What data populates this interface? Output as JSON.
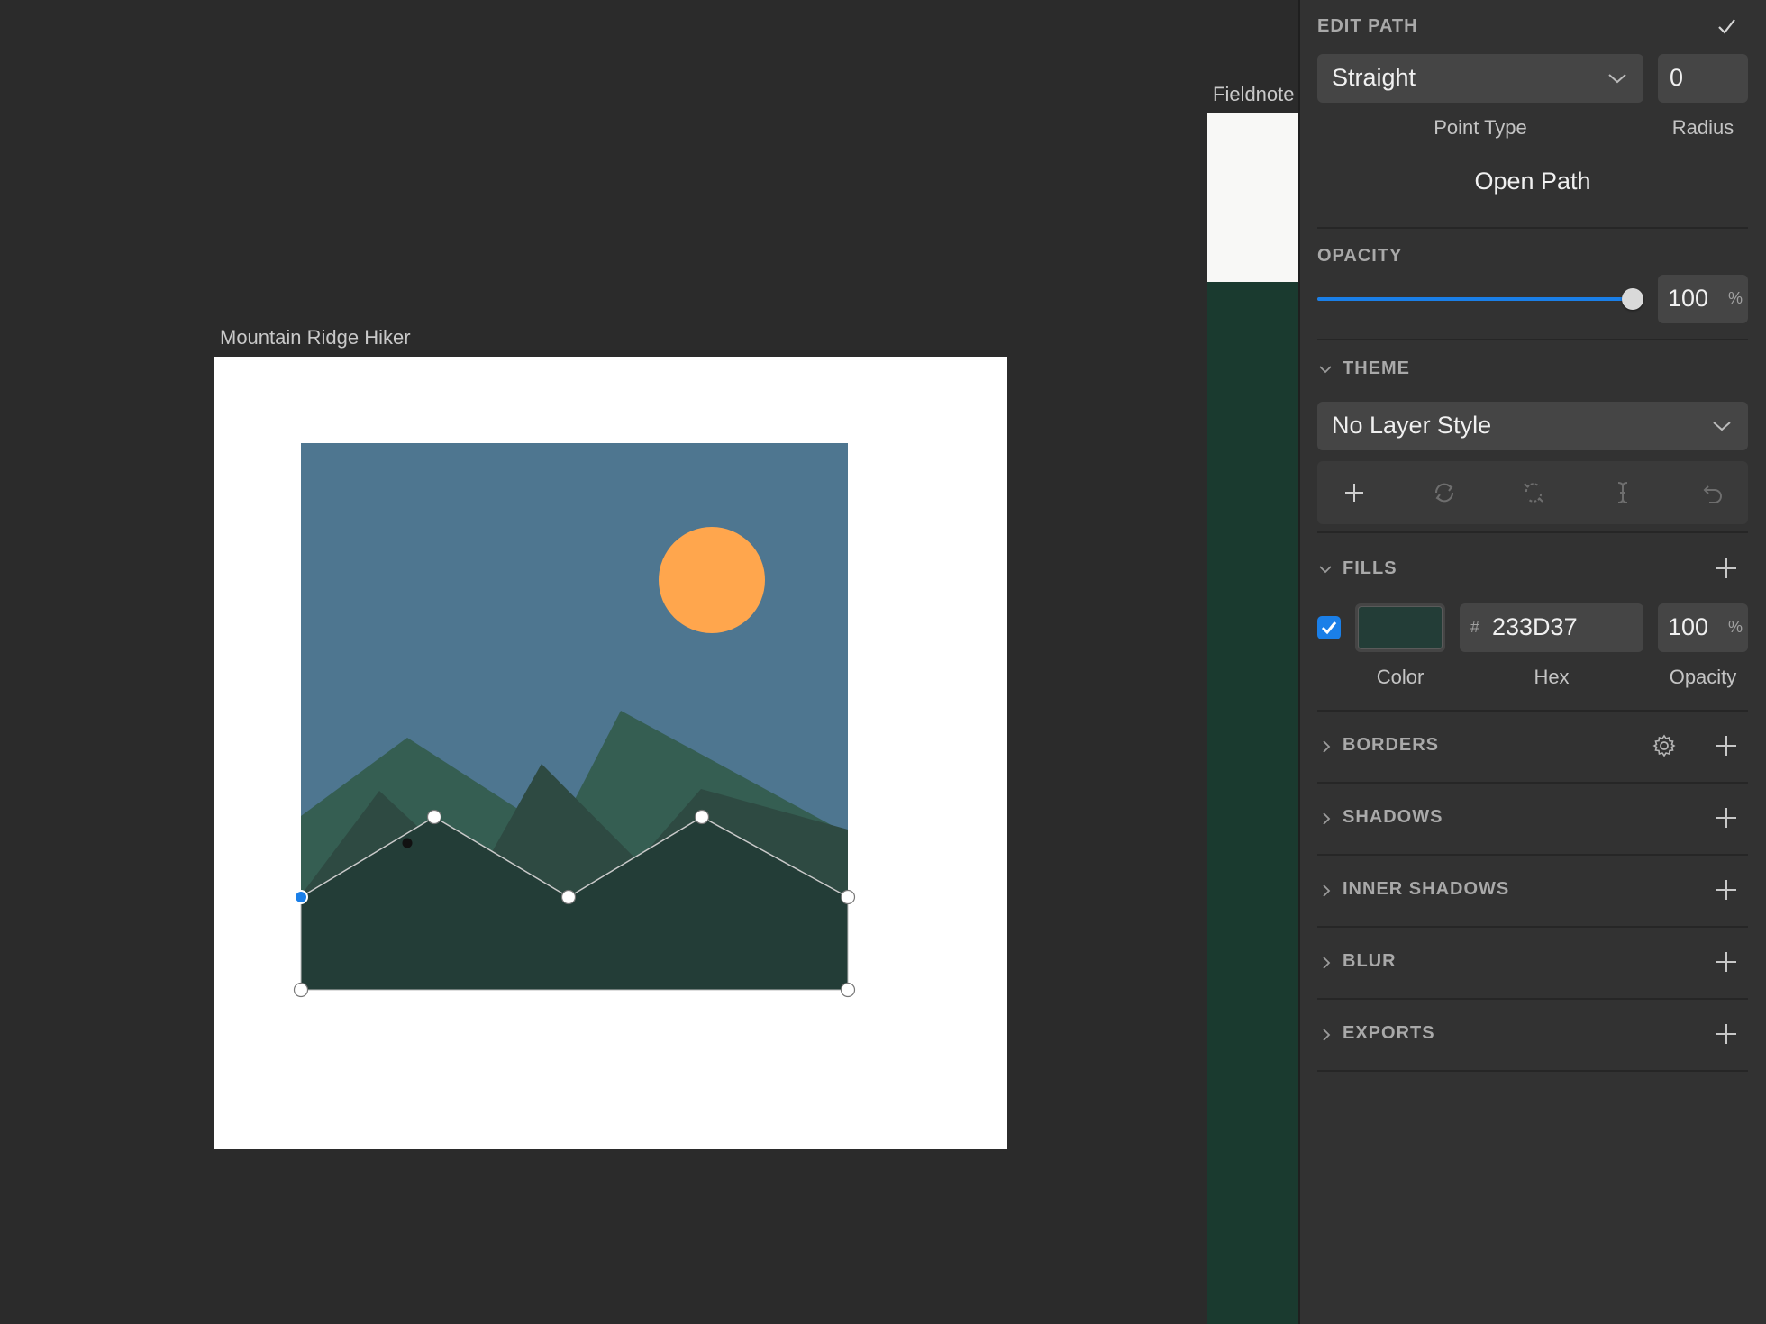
{
  "canvas": {
    "artboard1": {
      "title": "Mountain Ridge Hiker"
    },
    "artboard2": {
      "title": "Fieldnote"
    }
  },
  "inspector": {
    "edit_path": {
      "title": "EDIT PATH",
      "done_icon": "checkmark-icon",
      "point_type": {
        "value": "Straight",
        "caption": "Point Type"
      },
      "radius": {
        "value": "0",
        "caption": "Radius"
      },
      "open_path_label": "Open Path"
    },
    "opacity": {
      "title": "OPACITY",
      "value": "100",
      "unit": "%",
      "level": 1.0
    },
    "theme": {
      "title": "THEME",
      "layer_style": "No Layer Style",
      "tool_icons": [
        "plus-icon",
        "sync-icon",
        "detach-icon",
        "text-cursor-icon",
        "undo-icon"
      ]
    },
    "fills": {
      "title": "FILLS",
      "enabled": true,
      "color": "#233D37",
      "hex_prefix": "#",
      "hex": "233D37",
      "opacity": "100",
      "unit": "%",
      "captions": {
        "color": "Color",
        "hex": "Hex",
        "opacity": "Opacity"
      }
    },
    "sections": [
      {
        "title": "BORDERS",
        "has_settings": true
      },
      {
        "title": "SHADOWS"
      },
      {
        "title": "INNER SHADOWS"
      },
      {
        "title": "BLUR"
      },
      {
        "title": "EXPORTS"
      }
    ]
  },
  "colors": {
    "sky": "#4E7690",
    "sun": "#FFA64D",
    "mountain_mid": "#355E52",
    "mountain_dark": "#2E4A42",
    "path_fill": "#233D37",
    "accent_blue": "#1A7FE8"
  }
}
